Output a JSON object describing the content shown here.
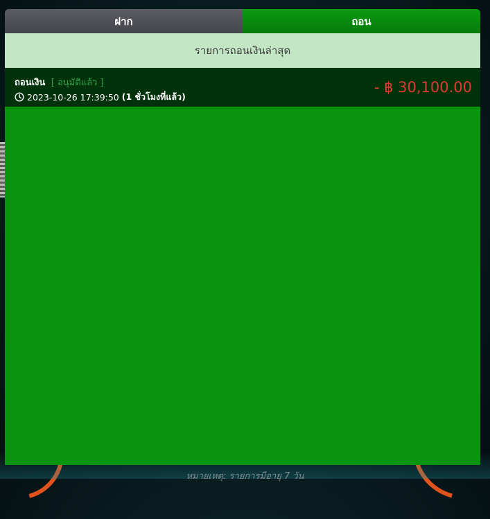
{
  "tabs": [
    {
      "label": "ฝาก",
      "active": false
    },
    {
      "label": "ถอน",
      "active": true
    }
  ],
  "section_title": "รายการถอนเงินล่าสุด",
  "transactions": [
    {
      "type": "ถอนเงิน",
      "status": "[ อนุมัติแล้ว ]",
      "date": "2023-10-26 17:39:50",
      "relative": "(1 ชั่วโมงที่แล้ว)",
      "amount": "- ฿ 30,100.00",
      "icon": "clock-icon"
    }
  ],
  "footer_note": "หมายเหตุ: รายการมีอายุ 7 วัน",
  "colors": {
    "panel_green": "#08940c",
    "active_tab": "#0a9a0f",
    "inactive_tab": "#55555c",
    "header_bg": "#c3e6c4",
    "row_bg": "#02320a",
    "amount_red": "#e03a35",
    "status_green": "#2fa34a"
  }
}
